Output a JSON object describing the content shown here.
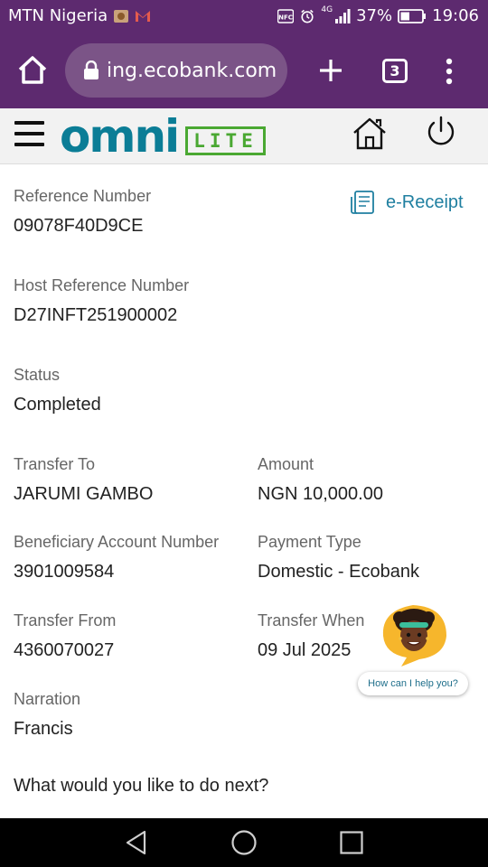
{
  "status_bar": {
    "carrier": "MTN Nigeria",
    "network": "4G",
    "battery": "37%",
    "time": "19:06"
  },
  "browser": {
    "url": "ing.ecobank.com",
    "tab_count": "3"
  },
  "header": {
    "logo_main": "omni",
    "logo_sub": "LITE"
  },
  "details": {
    "ereceipt_label": "e-Receipt",
    "reference_number_label": "Reference Number",
    "reference_number": "09078F40D9CE",
    "host_reference_label": "Host Reference Number",
    "host_reference": "D27INFT251900002",
    "status_label": "Status",
    "status": "Completed",
    "transfer_to_label": "Transfer To",
    "transfer_to": "JARUMI GAMBO",
    "amount_label": "Amount",
    "amount": "NGN 10,000.00",
    "beneficiary_account_label": "Beneficiary Account Number",
    "beneficiary_account": "3901009584",
    "payment_type_label": "Payment Type",
    "payment_type": "Domestic - Ecobank",
    "transfer_from_label": "Transfer From",
    "transfer_from": "4360070027",
    "transfer_when_label": "Transfer When",
    "transfer_when": "09 Jul 2025",
    "narration_label": "Narration",
    "narration": "Francis"
  },
  "next_prompt": "What would you like to do next?",
  "assistant": {
    "help_text": "How can I help you?"
  },
  "colors": {
    "browser_bar": "#5d2a6f",
    "brand_teal": "#0b7d96",
    "brand_green": "#4aa832",
    "link_blue": "#1f7fa0"
  }
}
